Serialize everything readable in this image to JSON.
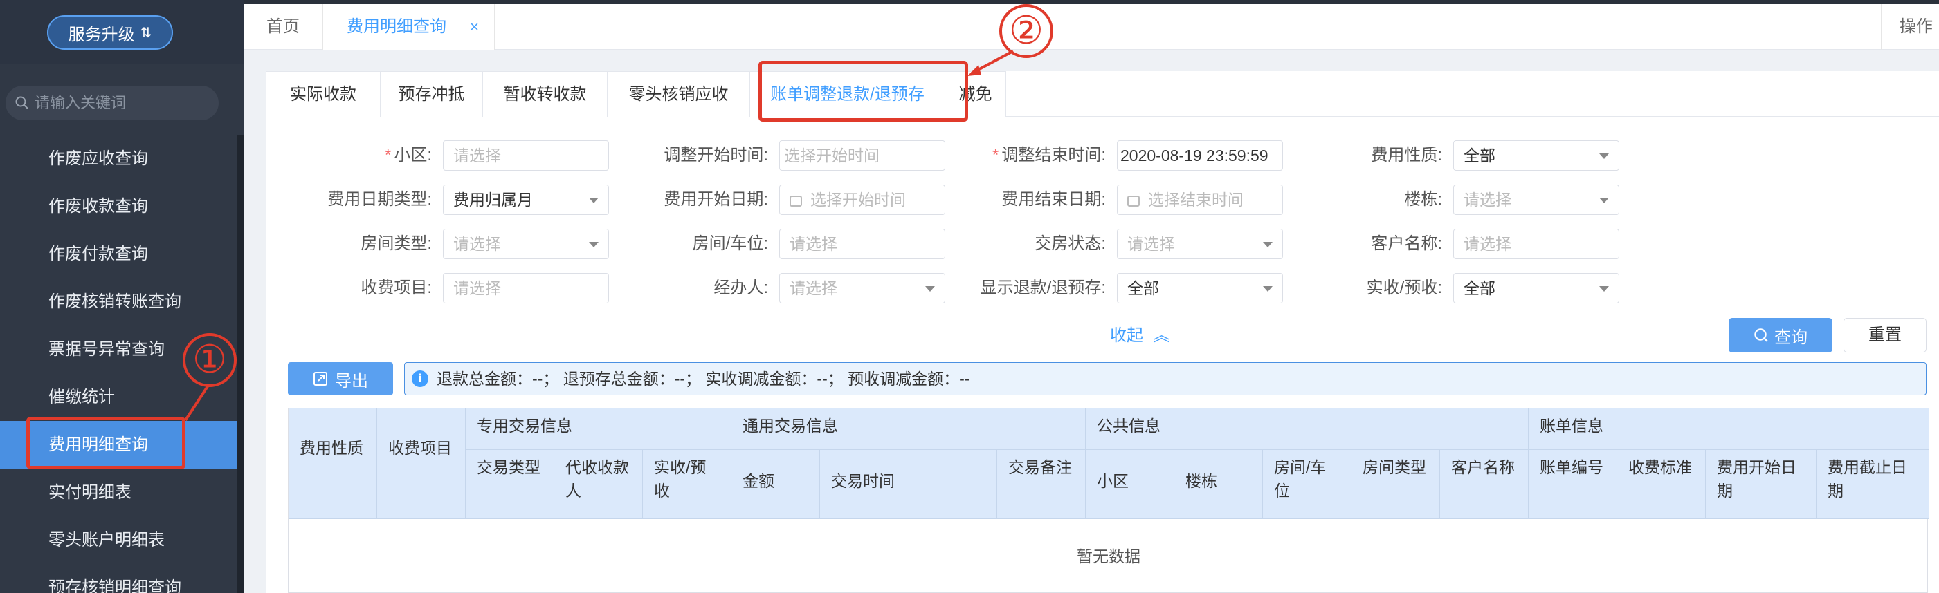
{
  "sidebar": {
    "upgrade_label": "服务升级",
    "upgrade_icon": "sort-arrows-icon",
    "search_placeholder": "请输入关键词",
    "items": [
      {
        "label": "作废应收查询"
      },
      {
        "label": "作废收款查询"
      },
      {
        "label": "作废付款查询"
      },
      {
        "label": "作废核销转账查询"
      },
      {
        "label": "票据号异常查询"
      },
      {
        "label": "催缴统计"
      },
      {
        "label": "费用明细查询",
        "active": true
      },
      {
        "label": "实付明细表"
      },
      {
        "label": "零头账户明细表"
      },
      {
        "label": "预存核销明细查询"
      }
    ]
  },
  "page_tabs": {
    "home": "首页",
    "current": "费用明细查询",
    "close_symbol": "×",
    "ops": "操作"
  },
  "sub_tabs": [
    "实际收款",
    "预存冲抵",
    "暂收转收款",
    "零头核销应收",
    "账单调整退款/退预存",
    "减免"
  ],
  "form": {
    "community_label": "小区:",
    "community_placeholder": "请选择",
    "adj_start_label": "调整开始时间:",
    "adj_start_placeholder": "选择开始时间",
    "adj_end_label": "调整结束时间:",
    "adj_end_value": "2020-08-19 23:59:59",
    "fee_nature_label": "费用性质:",
    "fee_nature_value": "全部",
    "fee_date_type_label": "费用日期类型:",
    "fee_date_type_value": "费用归属月",
    "fee_start_label": "费用开始日期:",
    "fee_start_placeholder": "选择开始时间",
    "fee_end_label": "费用结束日期:",
    "fee_end_placeholder": "选择结束时间",
    "building_label": "楼栋:",
    "building_placeholder": "请选择",
    "room_type_label": "房间类型:",
    "room_type_placeholder": "请选择",
    "room_label": "房间/车位:",
    "room_placeholder": "请选择",
    "handover_label": "交房状态:",
    "handover_placeholder": "请选择",
    "customer_label": "客户名称:",
    "customer_placeholder": "请选择",
    "fee_item_label": "收费项目:",
    "fee_item_placeholder": "请选择",
    "handler_label": "经办人:",
    "handler_placeholder": "请选择",
    "show_refund_label": "显示退款/退预存:",
    "show_refund_value": "全部",
    "receipt_label": "实收/预收:",
    "receipt_value": "全部",
    "collapse_label": "收起"
  },
  "buttons": {
    "query": "查询",
    "reset": "重置",
    "export": "导出"
  },
  "summary": "退款总金额：--；  退预存总金额：--；  实收调减金额：--；  预收调减金额：--",
  "table": {
    "group_headers": [
      "专用交易信息",
      "通用交易信息",
      "公共信息",
      "账单信息"
    ],
    "headers": [
      "费用性质",
      "收费项目",
      "交易类型",
      "代收收款人",
      "实收/预收",
      "金额",
      "交易时间",
      "交易备注",
      "小区",
      "楼栋",
      "房间/车位",
      "房间类型",
      "客户名称",
      "账单编号",
      "收费标准",
      "费用开始日期",
      "费用截止日期"
    ],
    "empty_text": "暂无数据"
  },
  "annotations": [
    "①",
    "②"
  ],
  "colors": {
    "accent": "#409eff",
    "sidebar_bg": "#303845",
    "annotation": "#e03a2b"
  }
}
